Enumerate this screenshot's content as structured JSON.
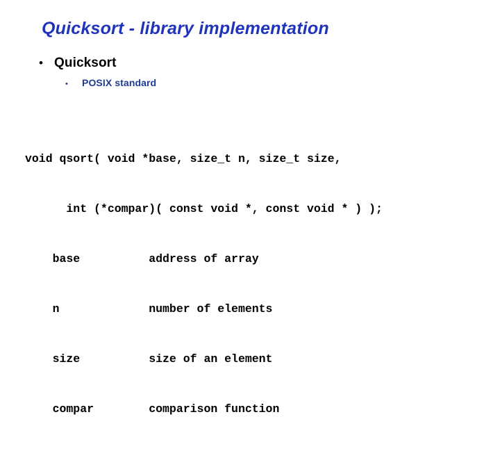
{
  "slide": {
    "title": "Quicksort - library implementation",
    "title_color": "#1f33bb",
    "background_color": "#ffffff"
  },
  "bullets": {
    "level1": {
      "glyph": "•",
      "label": "Quicksort",
      "color": "#000000"
    },
    "level2": {
      "glyph": "•",
      "label": "POSIX standard",
      "color": "#1f3a93"
    }
  },
  "code": {
    "color": "#000000",
    "lines": [
      "void qsort( void *base, size_t n, size_t size,",
      "      int (*compar)( const void *, const void * ) );",
      "    base          address of array",
      "    n             number of elements",
      "    size          size of an element",
      "    compar        comparison function"
    ],
    "signature": {
      "return_type": "void",
      "function_name": "qsort",
      "parameters": [
        {
          "name": "base",
          "type": "void *",
          "description": "address of array"
        },
        {
          "name": "n",
          "type": "size_t",
          "description": "number of elements"
        },
        {
          "name": "size",
          "type": "size_t",
          "description": "size of an element"
        },
        {
          "name": "compar",
          "type": "int (*)( const void *, const void * )",
          "description": "comparison function"
        }
      ]
    }
  }
}
